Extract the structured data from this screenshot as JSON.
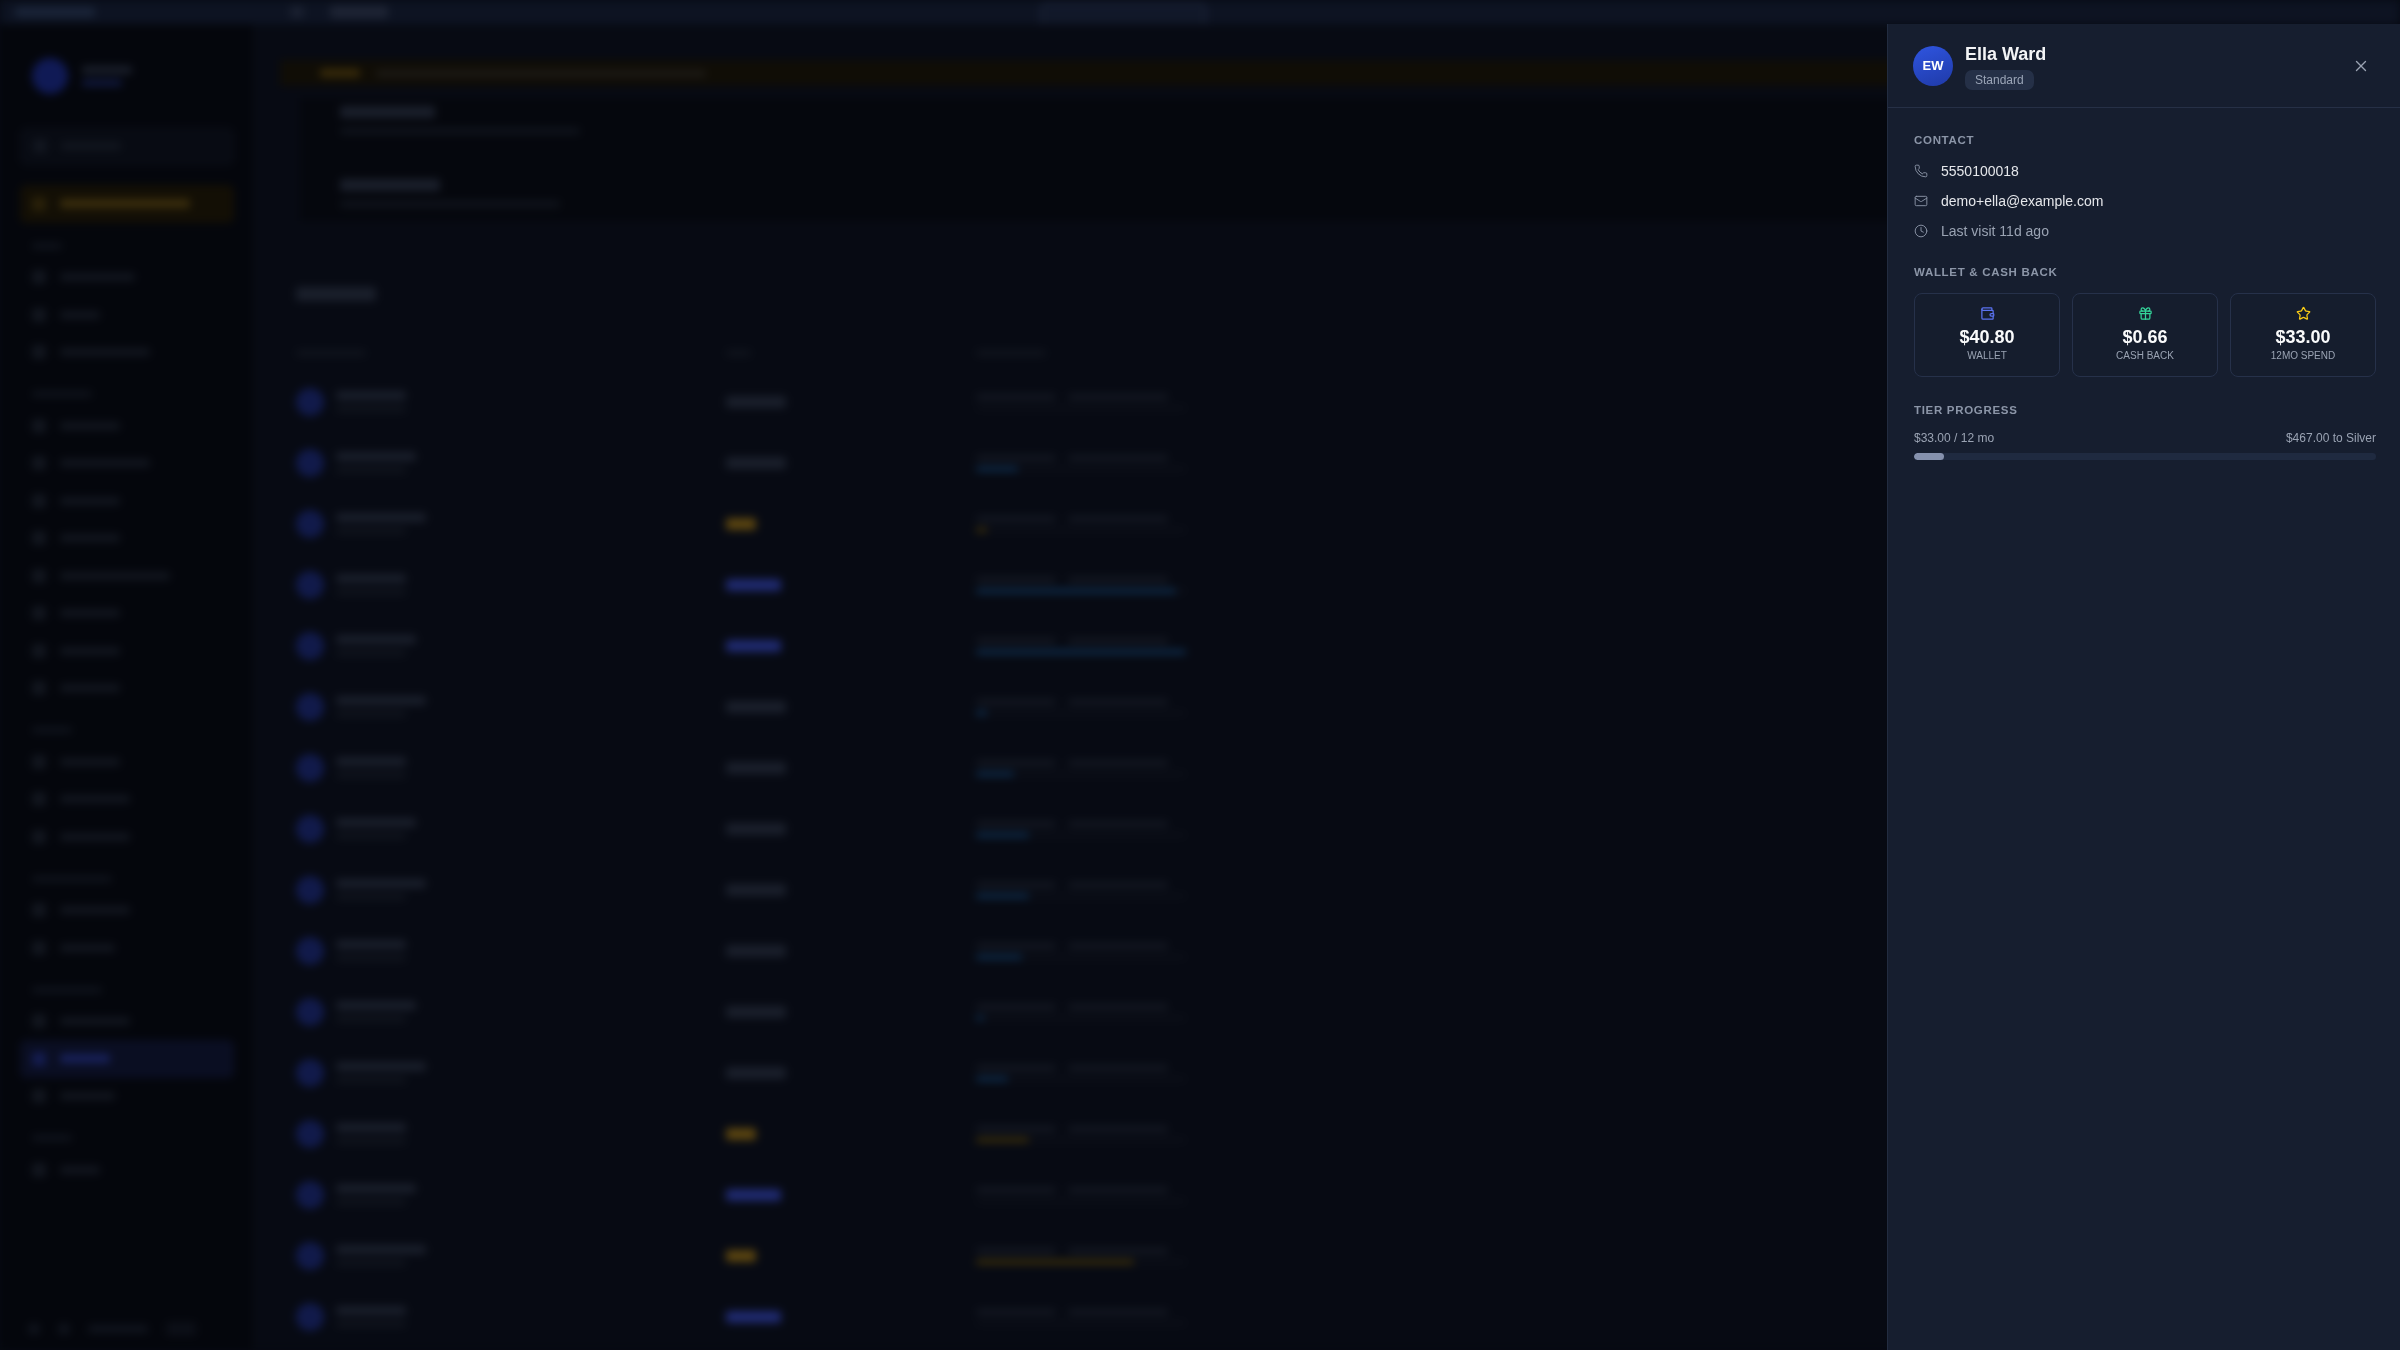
{
  "drawer": {
    "avatar_initials": "EW",
    "name": "Ella Ward",
    "tier_badge": "Standard",
    "contact": {
      "heading": "CONTACT",
      "items": [
        {
          "kind": "phone",
          "text": "5550100018"
        },
        {
          "kind": "email",
          "text": "demo+ella@example.com"
        },
        {
          "kind": "last_visit",
          "text": "Last visit 11d ago"
        }
      ]
    },
    "wallet": {
      "heading": "WALLET & CASH BACK",
      "stats": [
        {
          "kind": "wallet",
          "value": "$40.80",
          "label": "WALLET"
        },
        {
          "kind": "cash_back",
          "value": "$0.66",
          "label": "CASH BACK"
        },
        {
          "kind": "spend",
          "value": "$33.00",
          "label": "12MO SPEND"
        }
      ]
    },
    "tier_progress": {
      "heading": "TIER PROGRESS",
      "current": "$33.00 / 12 mo",
      "remaining": "$467.00 to Silver",
      "level": 0.066
    }
  }
}
